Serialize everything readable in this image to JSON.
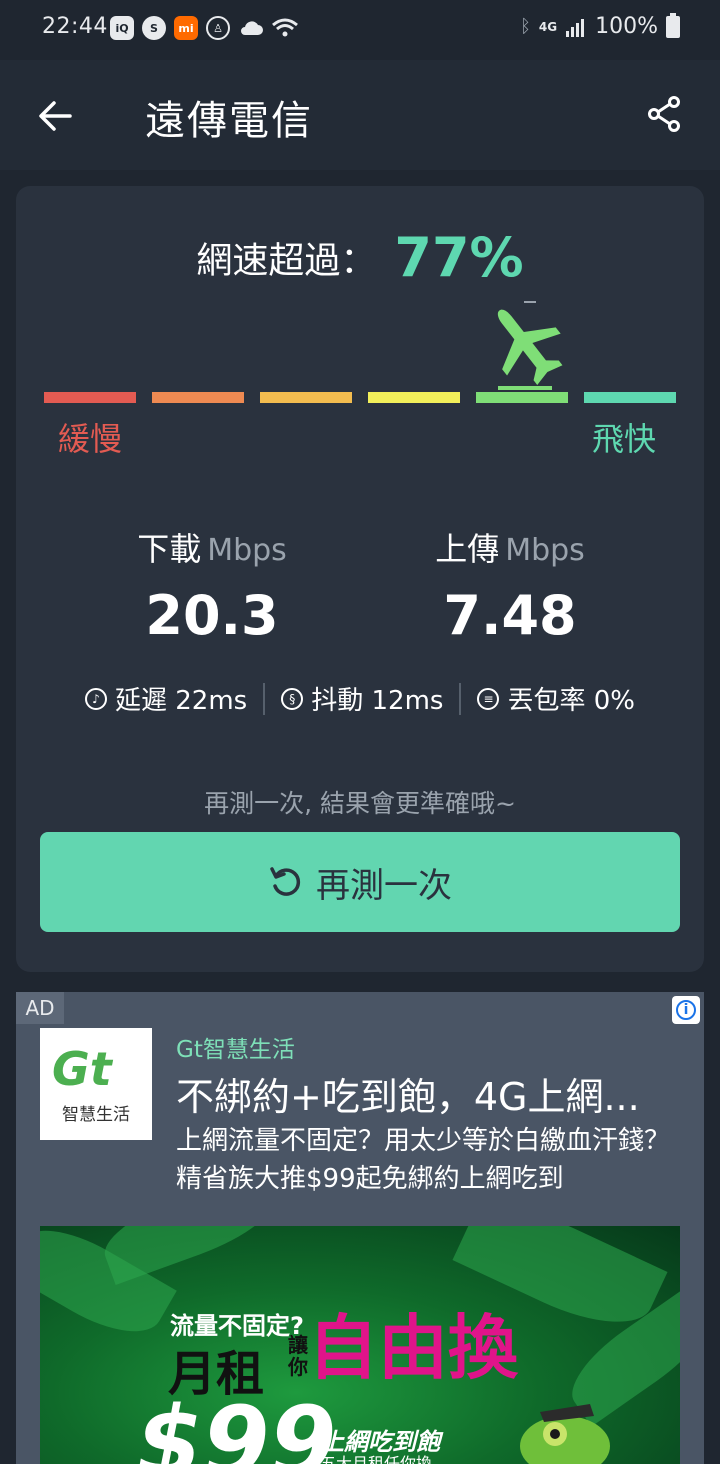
{
  "status_bar": {
    "time": "22:44",
    "network": "4G",
    "battery": "100%"
  },
  "app_bar": {
    "title": "遠傳電信"
  },
  "result": {
    "exceed_label": "網速超過：",
    "exceed_value": "77%",
    "scale_slow": "緩慢",
    "scale_fast": "飛快",
    "scale_colors": [
      "#e35b52",
      "#ee8a52",
      "#f3bc4f",
      "#f2ef5a",
      "#7fde77",
      "#5ed8b0"
    ],
    "active_segment": 5,
    "download_label": "下載",
    "download_unit": "Mbps",
    "download_value": "20.3",
    "upload_label": "上傳",
    "upload_unit": "Mbps",
    "upload_value": "7.48",
    "latency": "延遲 22ms",
    "jitter": "抖動 12ms",
    "packet_loss": "丟包率 0%",
    "hint": "再測一次, 結果會更準確哦~",
    "retry_label": "再測一次"
  },
  "ad": {
    "badge": "AD",
    "logo_mark": "Gt",
    "logo_text": "智慧生活",
    "brand": "Gt智慧生活",
    "headline": "不綁約+吃到飽，4G上網...",
    "body": "上網流量不固定？用太少等於白繳血汗錢？精省族大推$99起免綁約上網吃到",
    "promo_sub": "流量不固定?",
    "promo_main": "月租",
    "promo_let": "讓你",
    "promo_big": "自由換",
    "promo_price": "$99",
    "promo_line1": "上網吃到飽",
    "promo_line2": "五大月租任你換"
  }
}
